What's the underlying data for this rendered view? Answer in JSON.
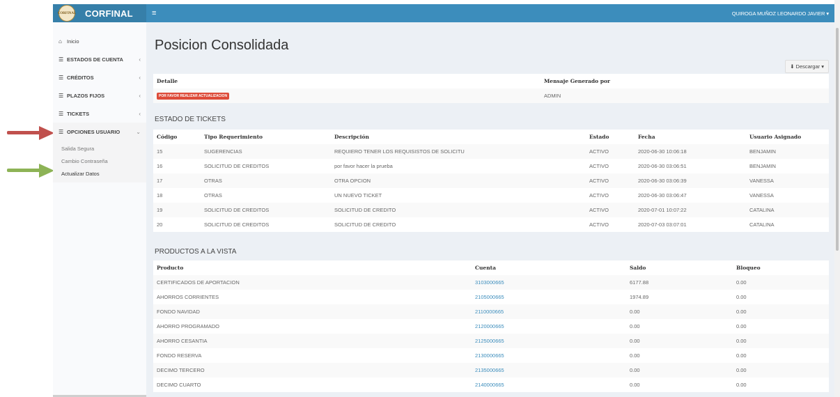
{
  "header": {
    "brand": "CORFINAL",
    "logo_text": "CORFINAL",
    "menu_toggle": "≡",
    "user": "QUIROGA MUÑOZ LEONARDO JAVIER ▾"
  },
  "sidebar": {
    "items": [
      {
        "label": "Inicio",
        "icon": "home-icon",
        "glyph": "⌂",
        "caret": ""
      },
      {
        "label": "ESTADOS DE CUENTA",
        "icon": "list-icon",
        "glyph": "☰",
        "caret": "‹"
      },
      {
        "label": "CRÉDITOS",
        "icon": "list-icon",
        "glyph": "☰",
        "caret": "‹"
      },
      {
        "label": "PLAZOS FIJOS",
        "icon": "list-icon",
        "glyph": "☰",
        "caret": "‹"
      },
      {
        "label": "TICKETS",
        "icon": "list-icon",
        "glyph": "☰",
        "caret": "‹"
      },
      {
        "label": "OPCIONES USUARIO",
        "icon": "list-icon",
        "glyph": "☰",
        "caret": "⌄"
      }
    ],
    "submenu": [
      "Salida Segura",
      "Cambio Contraseña",
      "Actualizar Datos"
    ]
  },
  "main": {
    "title": "Posicion Consolidada",
    "download_label": "Descargar ▾",
    "download_icon": "download-icon",
    "messages": {
      "headers": [
        "Detalle",
        "Mensaje Generado por"
      ],
      "badge": "POR FAVOR REALIZAR ACTUALIZACION",
      "generated_by": "ADMIN"
    },
    "tickets": {
      "section_title": "ESTADO DE TICKETS",
      "headers": [
        "Código",
        "Tipo Requerimiento",
        "Descripción",
        "Estado",
        "Fecha",
        "Usuario Asignado"
      ],
      "rows": [
        [
          "15",
          "SUGERENCIAS",
          "REQUIERO TENER LOS REQUISISTOS DE SOLICITU",
          "ACTIVO",
          "2020-06-30 10:06:18",
          "BENJAMIN"
        ],
        [
          "16",
          "SOLICITUD DE CREDITOS",
          "por favor hacer la prueba",
          "ACTIVO",
          "2020-06-30 03:06:51",
          "BENJAMIN"
        ],
        [
          "17",
          "OTRAS",
          "OTRA OPCION",
          "ACTIVO",
          "2020-06-30 03:06:39",
          "VANESSA"
        ],
        [
          "18",
          "OTRAS",
          "UN NUEVO TICKET",
          "ACTIVO",
          "2020-06-30 03:06:47",
          "VANESSA"
        ],
        [
          "19",
          "SOLICITUD DE CREDITOS",
          "SOLICITUD DE CREDITO",
          "ACTIVO",
          "2020-07-01 10:07:22",
          "CATALINA"
        ],
        [
          "20",
          "SOLICITUD DE CREDITOS",
          "SOLICITUD DE CREDITO",
          "ACTIVO",
          "2020-07-03 03:07:01",
          "CATALINA"
        ]
      ]
    },
    "products": {
      "section_title": "PRODUCTOS A LA VISTA",
      "headers": [
        "Producto",
        "Cuenta",
        "Saldo",
        "Bloqueo"
      ],
      "rows": [
        [
          "CERTIFICADOS DE APORTACION",
          "3103000665",
          "6177.88",
          "0.00"
        ],
        [
          "AHORROS CORRIENTES",
          "2105000665",
          "1974.89",
          "0.00"
        ],
        [
          "FONDO NAVIDAD",
          "2110000665",
          "0.00",
          "0.00"
        ],
        [
          "AHORRO PROGRAMADO",
          "2120000665",
          "0.00",
          "0.00"
        ],
        [
          "AHORRO CESANTIA",
          "2125000665",
          "0.00",
          "0.00"
        ],
        [
          "FONDO RESERVA",
          "2130000665",
          "0.00",
          "0.00"
        ],
        [
          "DECIMO TERCERO",
          "2135000665",
          "0.00",
          "0.00"
        ],
        [
          "DECIMO CUARTO",
          "2140000665",
          "0.00",
          "0.00"
        ]
      ]
    }
  },
  "colors": {
    "header_primary": "#3c8dbc",
    "header_logo": "#367fa9",
    "badge_danger": "#dd4b39",
    "arrow_red": "#c0504d",
    "arrow_green": "#8db356"
  }
}
